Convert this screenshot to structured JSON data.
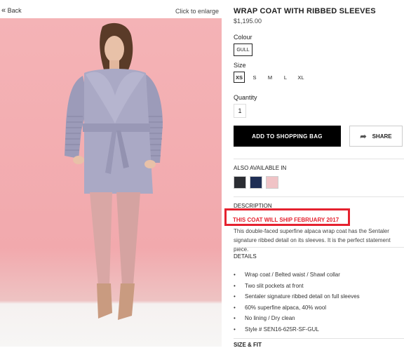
{
  "nav": {
    "back_label": "Back",
    "enlarge_label": "Click to enlarge"
  },
  "product": {
    "title": "WRAP COAT WITH RIBBED SLEEVES",
    "price": "$1,195.00",
    "colour_label": "Colour",
    "colour_value": "GULL",
    "size_label": "Size",
    "sizes": [
      "XS",
      "S",
      "M",
      "L",
      "XL"
    ],
    "selected_size": "XS",
    "quantity_label": "Quantity",
    "quantity_value": "1",
    "add_button": "ADD TO SHOPPING BAG",
    "share_button": "SHARE"
  },
  "also_available": {
    "label": "ALSO AVAILABLE IN",
    "swatch_colors": [
      "#2b2d33",
      "#1f2f55",
      "#f0c3c6"
    ]
  },
  "description": {
    "label": "DESCRIPTION",
    "ship_notice": "THIS COAT WILL SHIP FEBRUARY 2017",
    "text": "This double-faced superfine alpaca wrap coat has the Sentaler signature ribbed detail on its sleeves. It is the perfect statement piece."
  },
  "details": {
    "label": "DETAILS",
    "items": [
      "Wrap coat / Belted waist / Shawl collar",
      "Two slit pockets at front",
      "Sentaler signature ribbed detail on full sleeves",
      "60% superfine alpaca, 40% wool",
      "No lining / Dry clean",
      "Style # SEN16-625R-SF-GUL"
    ],
    "bottom_partial": "SIZE & FIT"
  },
  "colors": {
    "accent_red": "#e5222f",
    "button_black": "#000000",
    "photo_bg": "#f2a9ad",
    "coat": "#a9a8c4"
  }
}
